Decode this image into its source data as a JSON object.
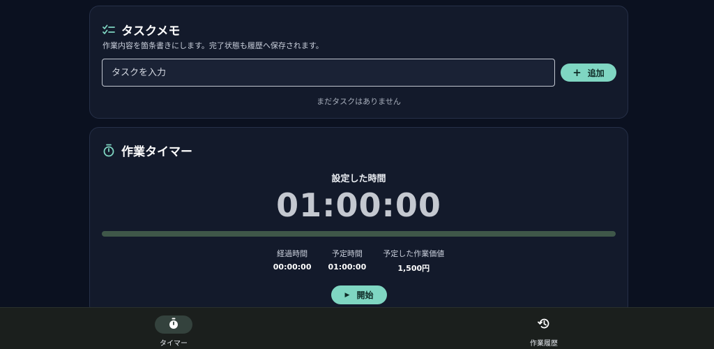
{
  "memo": {
    "title": "タスクメモ",
    "icon": "checklist-icon",
    "description": "作業内容を箇条書きにします。完了状態も履歴へ保存されます。",
    "input_placeholder": "タスクを入力",
    "add_label": "追加",
    "empty_text": "まだタスクはありません"
  },
  "timer": {
    "title": "作業タイマー",
    "icon": "stopwatch-icon",
    "set_time_label": "設定した時間",
    "display": "01:00:00",
    "progress": 0,
    "stats": [
      {
        "label": "経過時間",
        "value": "00:00:00"
      },
      {
        "label": "予定時間",
        "value": "01:00:00"
      },
      {
        "label": "予定した作業価値",
        "value": "1,500円"
      }
    ],
    "start_label": "開始"
  },
  "nav": {
    "timer_label": "タイマー",
    "history_label": "作業履歴"
  },
  "colors": {
    "accent": "#7fd6c2",
    "background": "#0b1120",
    "card": "#131a2b"
  }
}
